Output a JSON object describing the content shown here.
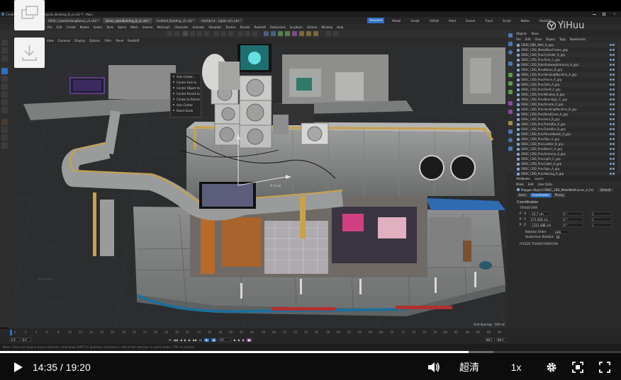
{
  "window": {
    "title": "Cinema 4D R25.010 - [Cyberpunk_Building_B_ol.c4d *] - Main"
  },
  "document_tabs": [
    {
      "label": "0000_CyberBuildingBonus_v3.c4d *"
    },
    {
      "label": "Bond_cyberBuilding_B_ol.c4d *"
    },
    {
      "label": "Untitled_Building_v1.c4d *"
    },
    {
      "label": "Untitled 4 - Lights v01.c4d *"
    }
  ],
  "layouts": [
    "Standard",
    "Model",
    "Sculpt",
    "UVEdit",
    "Paint",
    "Groom",
    "Track",
    "Script",
    "Nodes",
    "Redshift",
    "+"
  ],
  "menu": [
    "File",
    "Edit",
    "Create",
    "Modes",
    "Select",
    "Tools",
    "Spline",
    "Mesh",
    "Volume",
    "MoGraph",
    "Character",
    "Animate",
    "Simulate",
    "Tracker",
    "Render",
    "Redshift",
    "Extensions",
    "Insydium",
    "Octane",
    "Window",
    "Help"
  ],
  "viewport_menu": [
    "View",
    "Cameras",
    "Display",
    "Options",
    "Filter",
    "Panel",
    "Redshift"
  ],
  "viewport": {
    "grid_spacing": "Grid Spacing : 100 cm",
    "axis_label": "Perspective",
    "coord_readout": "X: 0 cm"
  },
  "context_menu": {
    "items": [
      "Axis Center...",
      "Center Axis to",
      "Center Object to",
      "Center Parent to",
      "Center to Parent",
      "Axis Center",
      "Reset Scale"
    ]
  },
  "objects_panel": {
    "tabs": [
      "Objects",
      "Takes"
    ],
    "menu": [
      "File",
      "Edit",
      "View",
      "Object",
      "Tags",
      "Bookmarks"
    ],
    "items": [
      "CB00_CBD_Wall_A_gep",
      "OBSC_CBD_MetalDoorFrame_gep",
      "OBSC_CBD_ProcCylinder_A_grp",
      "OBSC_CBD_ProcTank_C_grp",
      "OBSC_CBD_RipleSubwayEntrance_A_grp",
      "OBSC_CBD_PocaBoxes_B_grp",
      "OBSC_CBD_ProcVendingMachine_A_grp",
      "OBSC_CBD_ProcFence_A_grp",
      "OBSC_CBD_ProcSofa_A_grp",
      "OBSC_CBD_ProcShelf_A_grp",
      "OBSC_CBD_ProcWindow_B_grp",
      "OBSC_CBD_ProcNeonSign_C_grp",
      "OBSC_CBD_ProcArcade_A_grp",
      "OBSC_CBD_ProcVendingMachine_B_grp",
      "OBSC_CBD_ProcRoadCone_A_grp",
      "OBSC_CBD_ProcVent_B_grp",
      "OBSC_CBD_ProcTrashBin_A_grp",
      "OBSC_CBD_ProcTrashBin_B_grp",
      "OBSC_CBD_ProcPhoneBooth_A_grp",
      "OBSC_CBD_ProcPipe_A_grp",
      "OBSC_CBD_ProcLadder_B_grp",
      "OBSC_CBD_ProcBench_A_grp",
      "OBSC_CBD_ProcAntenna_A_grp",
      "OBSC_CBD_ProcLight_C_grp",
      "OBSC_CBD_ProcCable_A_grp",
      "OBSC_CBD_ProcSign_A_grp",
      "OBSC_CBD_ProcAwning_A_grp"
    ]
  },
  "attributes_panel": {
    "tabs": [
      "Attributes",
      "Layers"
    ],
    "menu": [
      "Mode",
      "Edit",
      "User Data"
    ],
    "object_title": "Polygon Object [OBSC_CBD_MetalWallCorner_A_Fa]",
    "default_label": "Default",
    "sub_tabs": [
      "Basic",
      "Coordinates",
      "Phong"
    ],
    "section": "Coordinates",
    "transform_label": "TRANSFORM",
    "rows": [
      {
        "axis": "P . X",
        "value": "-15.7 cm",
        "rot": "0 °",
        "scale": "1"
      },
      {
        "axis": "P . Y",
        "value": "271.026 cm",
        "rot": "0 °",
        "scale": "1"
      },
      {
        "axis": "P . Z",
        "value": "-1351.488 cm",
        "rot": "0 °",
        "scale": "1"
      }
    ],
    "rotation_order_label": "Rotation Order",
    "rotation_order_value": "HPB",
    "quaternion_label": "Quaternion Rotation",
    "freeze_label": "FREEZE TRANSFORMATION"
  },
  "timeline": {
    "current_frame": "0 F",
    "start": "0 F",
    "end": "90 F",
    "end2": "90 F",
    "frame_field": "0 F",
    "ticks": [
      "0",
      "2",
      "4",
      "6",
      "8",
      "10",
      "12",
      "14",
      "16",
      "18",
      "20",
      "22",
      "24",
      "26",
      "28",
      "30",
      "32",
      "34",
      "36",
      "38",
      "40",
      "42",
      "44",
      "46",
      "48",
      "50",
      "52",
      "54",
      "56",
      "58",
      "60",
      "62",
      "64",
      "66",
      "68",
      "70",
      "72",
      "74",
      "76",
      "78",
      "80",
      "82",
      "84",
      "86",
      "88",
      "90"
    ]
  },
  "statusbar": {
    "text": "Move: Click and drag to move elements. Hold down SHIFT to quantize movement / add to the selection in point mode, CTRL to remove."
  },
  "watermark": {
    "text": "YiHuu"
  },
  "overlay_buttons": {
    "float": "float-window-icon",
    "download": "download-icon"
  },
  "player": {
    "current_time": "14:35",
    "separator": " / ",
    "total_time": "19:20",
    "quality": "超清",
    "speed": "1x",
    "progress": 0.754
  },
  "colors": {
    "accent": "#2f6fbf",
    "progress": "#ffffff",
    "buffer": "#6a6a6a"
  }
}
